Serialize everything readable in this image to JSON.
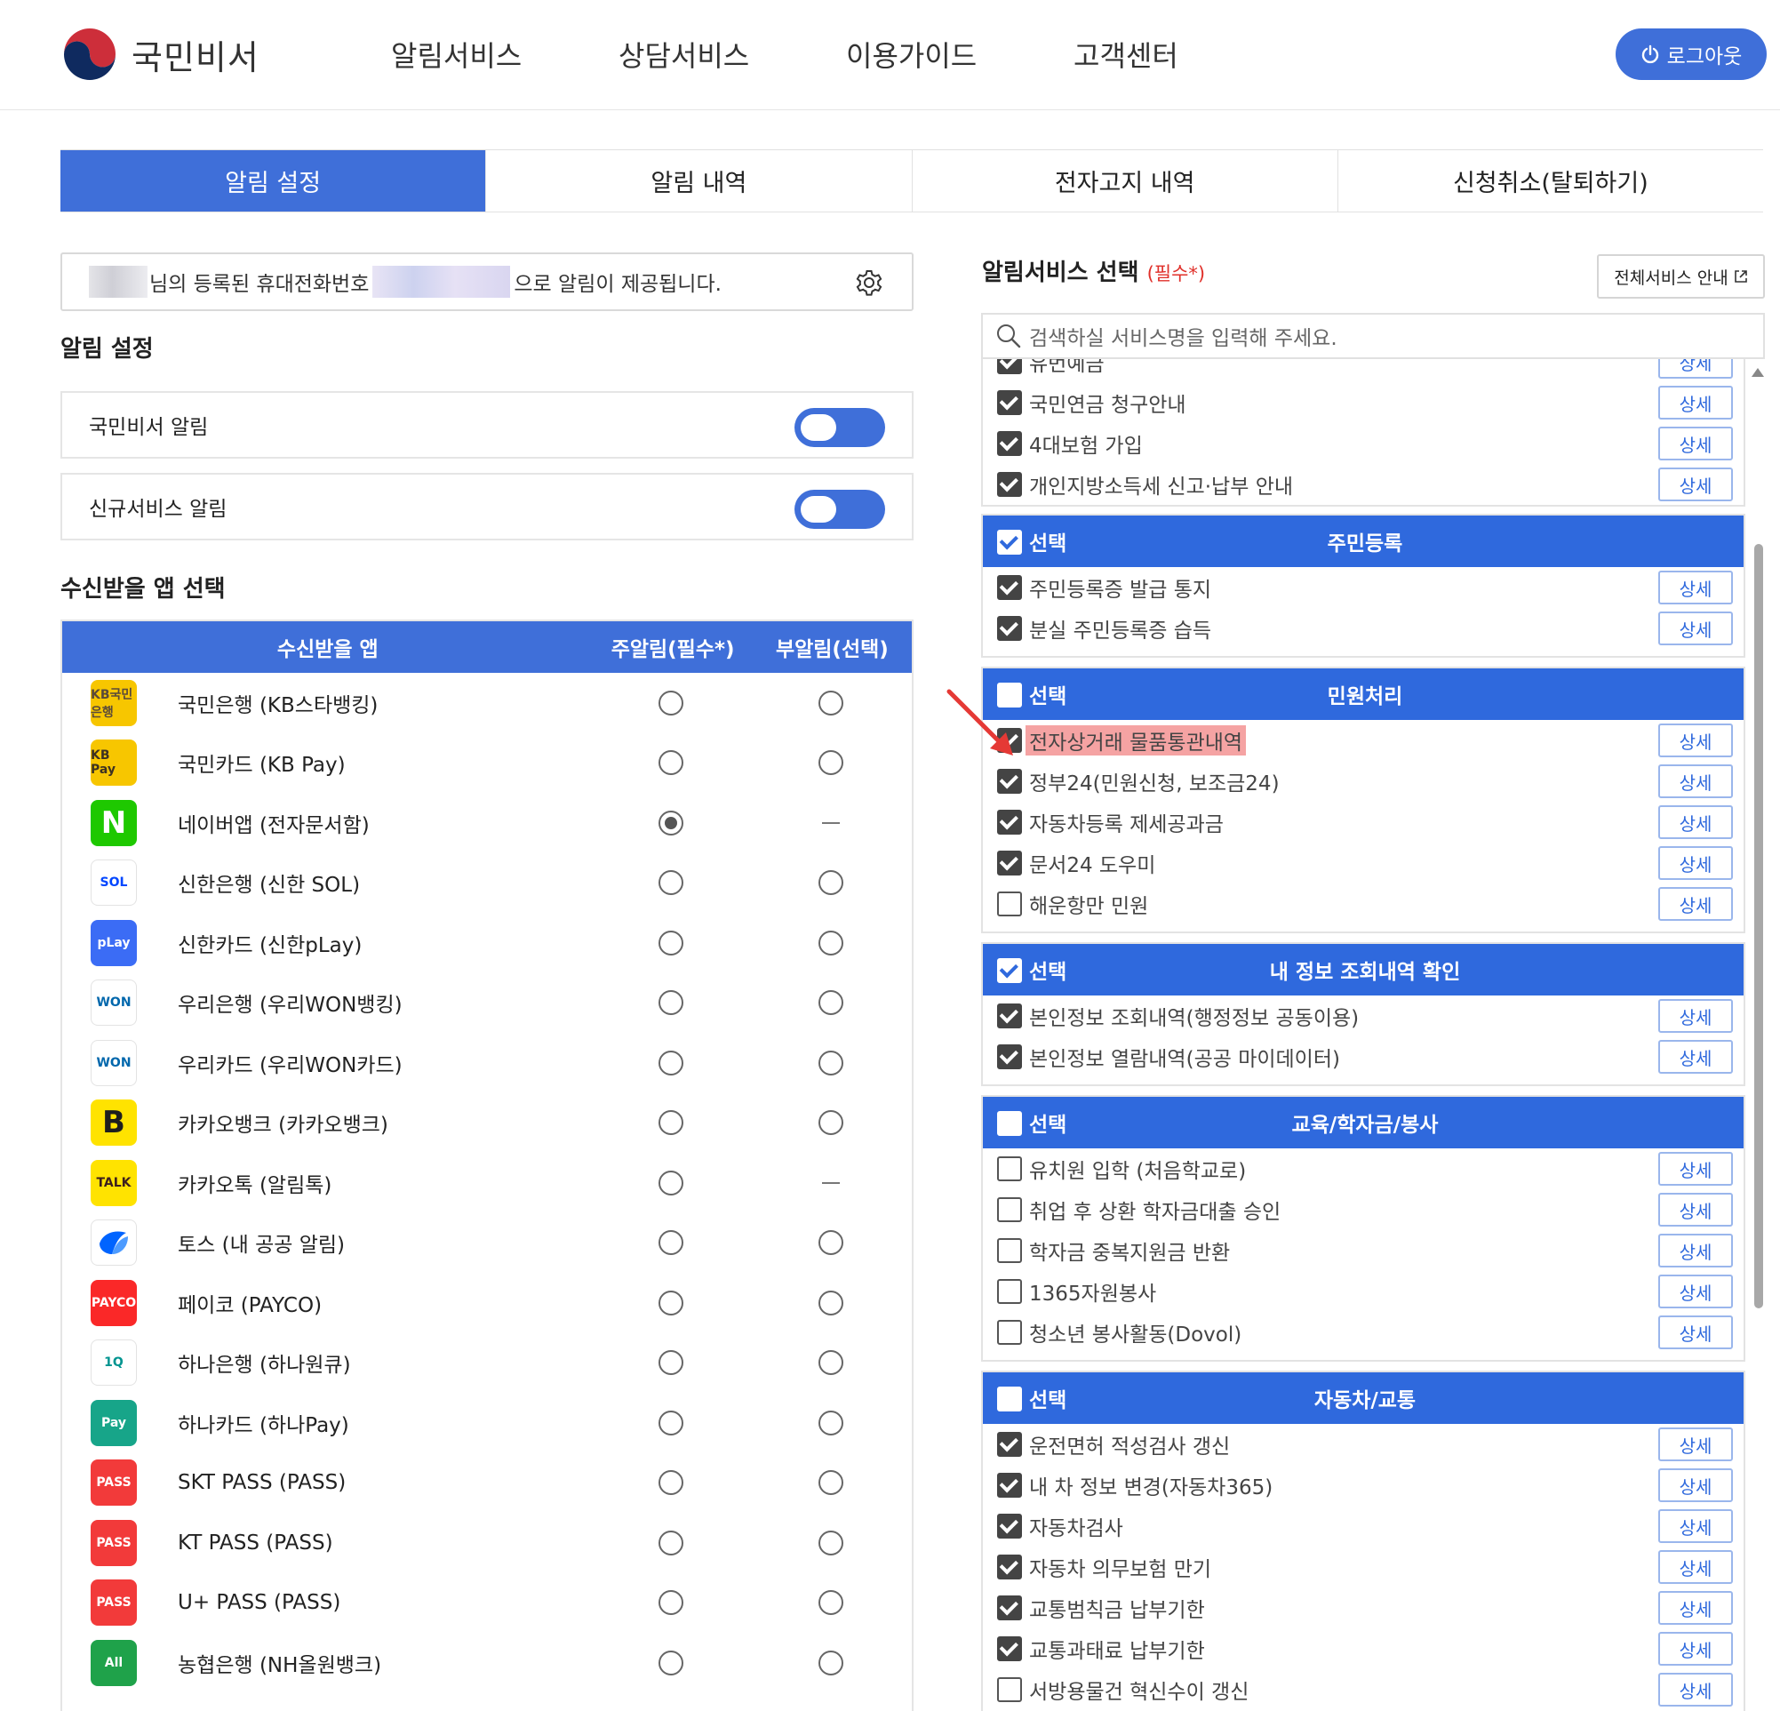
{
  "header": {
    "logo_text": "국민비서",
    "nav": [
      "알림서비스",
      "상담서비스",
      "이용가이드",
      "고객센터"
    ],
    "logout_label": "로그아웃",
    "colors": {
      "primary": "#3f6fd9",
      "logo_red": "#cd2e3a",
      "logo_blue": "#0f4ea0"
    }
  },
  "tabs": [
    {
      "label": "알림 설정",
      "active": true
    },
    {
      "label": "알림 내역",
      "active": false
    },
    {
      "label": "전자고지 내역",
      "active": false
    },
    {
      "label": "신청취소(탈퇴하기)",
      "active": false
    }
  ],
  "notice": {
    "text_before": "님의 등록된 휴대전화번호",
    "text_after": "으로 알림이 제공됩니다."
  },
  "alert_settings": {
    "title": "알림 설정",
    "toggles": [
      {
        "label": "국민비서 알림",
        "on": true
      },
      {
        "label": "신규서비스 알림",
        "on": true
      }
    ]
  },
  "app_select": {
    "title": "수신받을 앱 선택",
    "columns": [
      "수신받을 앱",
      "주알림(필수*)",
      "부알림(선택)"
    ],
    "apps": [
      {
        "name": "국민은행 (KB스타뱅킹)",
        "icon": "kb-star-icon",
        "icon_text": "KB국민은행",
        "bg": "#f7c600",
        "fg": "#5a4a3a",
        "main": false,
        "sub": "radio"
      },
      {
        "name": "국민카드 (KB Pay)",
        "icon": "kb-pay-icon",
        "icon_text": "KB Pay",
        "bg": "#f7c600",
        "fg": "#3d3222",
        "main": false,
        "sub": "radio"
      },
      {
        "name": "네이버앱 (전자문서함)",
        "icon": "naver-icon",
        "icon_text": "N",
        "bg": "#1ec800",
        "fg": "#ffffff",
        "main": true,
        "sub": "dash"
      },
      {
        "name": "신한은행 (신한 SOL)",
        "icon": "shinhan-sol-icon",
        "icon_text": "SOL",
        "bg": "#ffffff",
        "fg": "#0046ff",
        "main": false,
        "sub": "radio"
      },
      {
        "name": "신한카드 (신한pLay)",
        "icon": "shinhan-play-icon",
        "icon_text": "pLay",
        "bg": "#3b6cf5",
        "fg": "#ffffff",
        "main": false,
        "sub": "radio"
      },
      {
        "name": "우리은행 (우리WON뱅킹)",
        "icon": "woori-won-icon",
        "icon_text": "WON",
        "bg": "#ffffff",
        "fg": "#0067ac",
        "main": false,
        "sub": "radio"
      },
      {
        "name": "우리카드 (우리WON카드)",
        "icon": "woori-won-card-icon",
        "icon_text": "WON",
        "bg": "#ffffff",
        "fg": "#0067ac",
        "main": false,
        "sub": "radio"
      },
      {
        "name": "카카오뱅크 (카카오뱅크)",
        "icon": "kakaobank-icon",
        "icon_text": "B",
        "bg": "#ffe300",
        "fg": "#1e1e1e",
        "main": false,
        "sub": "radio"
      },
      {
        "name": "카카오톡 (알림톡)",
        "icon": "kakaotalk-icon",
        "icon_text": "TALK",
        "bg": "#ffe300",
        "fg": "#3c1e1e",
        "main": false,
        "sub": "dash"
      },
      {
        "name": "토스 (내 공공 알림)",
        "icon": "toss-icon",
        "icon_text": "",
        "bg": "#ffffff",
        "fg": "#0064ff",
        "main": false,
        "sub": "radio"
      },
      {
        "name": "페이코 (PAYCO)",
        "icon": "payco-icon",
        "icon_text": "PAYCO",
        "bg": "#fa2828",
        "fg": "#ffffff",
        "main": false,
        "sub": "radio"
      },
      {
        "name": "하나은행 (하나원큐)",
        "icon": "hana-1q-icon",
        "icon_text": "1Q",
        "bg": "#ffffff",
        "fg": "#009490",
        "main": false,
        "sub": "radio"
      },
      {
        "name": "하나카드 (하나Pay)",
        "icon": "hana-pay-icon",
        "icon_text": "Pay",
        "bg": "#17a589",
        "fg": "#ffffff",
        "main": false,
        "sub": "radio"
      },
      {
        "name": "SKT PASS (PASS)",
        "icon": "skt-pass-icon",
        "icon_text": "PASS",
        "bg": "#f23a3a",
        "fg": "#ffffff",
        "main": false,
        "sub": "radio"
      },
      {
        "name": "KT PASS (PASS)",
        "icon": "kt-pass-icon",
        "icon_text": "PASS",
        "bg": "#f23a3a",
        "fg": "#ffffff",
        "main": false,
        "sub": "radio"
      },
      {
        "name": "U+ PASS (PASS)",
        "icon": "uplus-pass-icon",
        "icon_text": "PASS",
        "bg": "#f23a3a",
        "fg": "#ffffff",
        "main": false,
        "sub": "radio"
      },
      {
        "name": "농협은행 (NH올원뱅크)",
        "icon": "nh-allone-icon",
        "icon_text": "All",
        "bg": "#1fa24a",
        "fg": "#ffffff",
        "main": false,
        "sub": "radio"
      }
    ]
  },
  "service_select": {
    "title": "알림서비스 선택",
    "required_mark": "(필수*)",
    "all_services_label": "전체서비스 안내",
    "search_placeholder": "검색하실 서비스명을 입력해 주세요.",
    "detail_label": "상세",
    "select_label": "선택",
    "top_items": [
      {
        "label": "유번예금",
        "checked": true
      },
      {
        "label": "국민연금 청구안내",
        "checked": true
      },
      {
        "label": "4대보험 가입",
        "checked": true
      },
      {
        "label": "개인지방소득세 신고·납부 안내",
        "checked": true
      }
    ],
    "groups": [
      {
        "name": "주민등록",
        "checked": true,
        "items": [
          {
            "label": "주민등록증 발급 통지",
            "checked": true
          },
          {
            "label": "분실 주민등록증 습득",
            "checked": true
          }
        ]
      },
      {
        "name": "민원처리",
        "checked": false,
        "items": [
          {
            "label": "전자상거래 물품통관내역",
            "checked": true,
            "highlight": true
          },
          {
            "label": "정부24(민원신청, 보조금24)",
            "checked": true
          },
          {
            "label": "자동차등록 제세공과금",
            "checked": true
          },
          {
            "label": "문서24 도우미",
            "checked": true
          },
          {
            "label": "해운항만 민원",
            "checked": false
          }
        ]
      },
      {
        "name": "내 정보 조회내역 확인",
        "checked": true,
        "items": [
          {
            "label": "본인정보 조회내역(행정정보 공동이용)",
            "checked": true
          },
          {
            "label": "본인정보 열람내역(공공 마이데이터)",
            "checked": true
          }
        ]
      },
      {
        "name": "교육/학자금/봉사",
        "checked": false,
        "items": [
          {
            "label": "유치원 입학 (처음학교로)",
            "checked": false
          },
          {
            "label": "취업 후 상환 학자금대출 승인",
            "checked": false
          },
          {
            "label": "학자금 중복지원금 반환",
            "checked": false
          },
          {
            "label": "1365자원봉사",
            "checked": false
          },
          {
            "label": "청소년 봉사활동(Dovol)",
            "checked": false
          }
        ]
      },
      {
        "name": "자동차/교통",
        "checked": false,
        "items": [
          {
            "label": "운전면허 적성검사 갱신",
            "checked": true
          },
          {
            "label": "내 차 정보 변경(자동차365)",
            "checked": true
          },
          {
            "label": "자동차검사",
            "checked": true
          },
          {
            "label": "자동차 의무보험 만기",
            "checked": true
          },
          {
            "label": "교통범칙금 납부기한",
            "checked": true
          },
          {
            "label": "교통과태료 납부기한",
            "checked": true
          },
          {
            "label": "서방용물건 혁신수이 갱신",
            "checked": false
          }
        ]
      }
    ]
  }
}
